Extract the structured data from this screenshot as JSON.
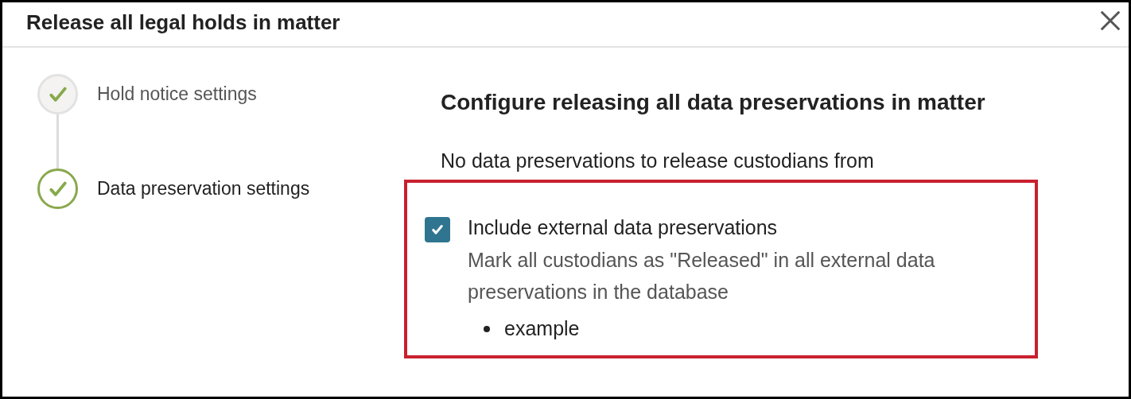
{
  "dialog": {
    "title": "Release all legal holds in matter"
  },
  "steps": [
    {
      "label": "Hold notice settings",
      "selected": false
    },
    {
      "label": "Data preservation settings",
      "selected": true
    }
  ],
  "content": {
    "heading": "Configure releasing all data preservations in matter",
    "message": "No data preservations to release custodians from",
    "option": {
      "label": "Include external data preservations",
      "checked": true,
      "description": "Mark all custodians as \"Released\" in all external data preservations in the database",
      "items": [
        "example"
      ]
    }
  }
}
